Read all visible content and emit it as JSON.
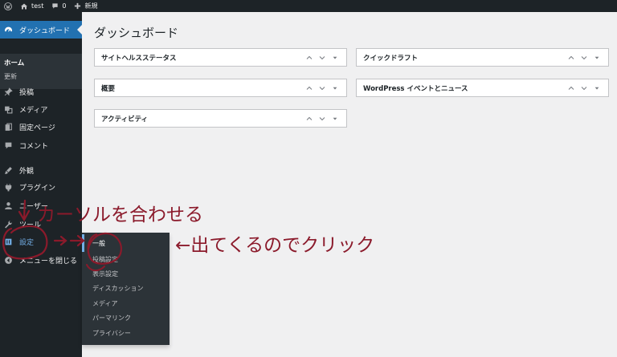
{
  "adminbar": {
    "site_name": "test",
    "comments_count": "0",
    "new_label": "新規"
  },
  "sidebar": {
    "dashboard_label": "ダッシュボード",
    "dashboard_submenu": {
      "home": "ホーム",
      "update": "更新"
    },
    "items": [
      {
        "label": "投稿",
        "icon": "pin-icon"
      },
      {
        "label": "メディア",
        "icon": "media-icon"
      },
      {
        "label": "固定ページ",
        "icon": "page-icon"
      },
      {
        "label": "コメント",
        "icon": "comment-icon"
      },
      {
        "label": "外観",
        "icon": "brush-icon"
      },
      {
        "label": "プラグイン",
        "icon": "plugin-icon"
      },
      {
        "label": "ユーザー",
        "icon": "user-icon"
      },
      {
        "label": "ツール",
        "icon": "wrench-icon"
      },
      {
        "label": "設定",
        "icon": "settings-icon"
      }
    ],
    "collapse_label": "メニューを閉じる"
  },
  "settings_flyout": {
    "items": [
      "一般",
      "投稿設定",
      "表示設定",
      "ディスカッション",
      "メディア",
      "パーマリンク",
      "プライバシー"
    ]
  },
  "main": {
    "title": "ダッシュボード",
    "widgets": [
      "サイトヘルスステータス",
      "クイックドラフト",
      "概要",
      "WordPress イベントとニュース",
      "アクティビティ"
    ]
  },
  "annotations": {
    "hover_hint": "カーソルを合わせる",
    "click_hint": "←出てくるのでクリック"
  },
  "colors": {
    "admin_dark": "#1d2327",
    "accent_blue": "#2271b1",
    "annotation_red": "#8b1a2b"
  }
}
